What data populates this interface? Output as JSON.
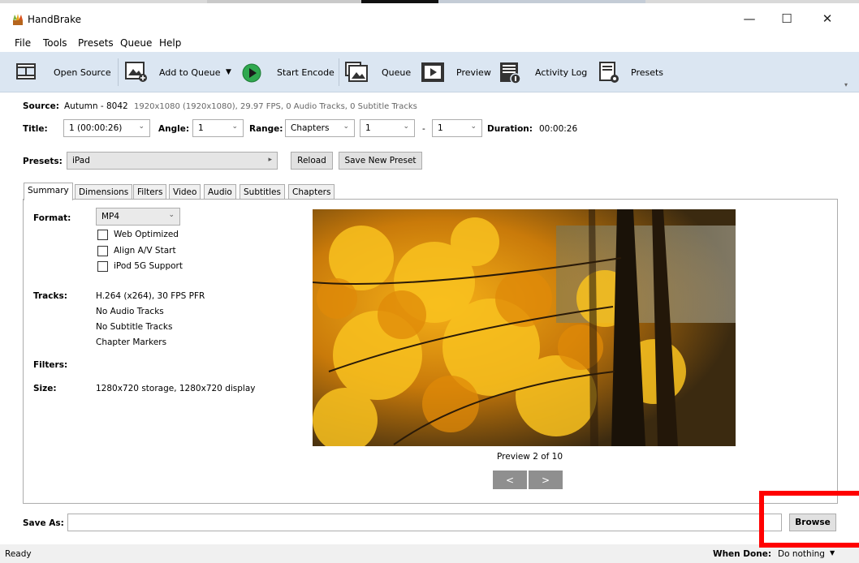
{
  "window": {
    "title": "HandBrake"
  },
  "menu": [
    "File",
    "Tools",
    "Presets",
    "Queue",
    "Help"
  ],
  "toolbar": {
    "open_source": "Open Source",
    "add_to_queue": "Add to Queue",
    "start_encode": "Start Encode",
    "queue": "Queue",
    "preview": "Preview",
    "activity_log": "Activity Log",
    "presets": "Presets"
  },
  "source": {
    "label": "Source:",
    "name": "Autumn - 8042",
    "info": "1920x1080 (1920x1080), 29.97 FPS, 0 Audio Tracks, 0 Subtitle Tracks"
  },
  "title_row": {
    "title_label": "Title:",
    "title_value": "1 (00:00:26)",
    "angle_label": "Angle:",
    "angle_value": "1",
    "range_label": "Range:",
    "range_value": "Chapters",
    "range_start": "1",
    "dash": "-",
    "range_end": "1",
    "duration_label": "Duration:",
    "duration_value": "00:00:26"
  },
  "presets_row": {
    "label": "Presets:",
    "value": "iPad",
    "reload": "Reload",
    "save_new": "Save New Preset"
  },
  "tabs": [
    "Summary",
    "Dimensions",
    "Filters",
    "Video",
    "Audio",
    "Subtitles",
    "Chapters"
  ],
  "summary": {
    "format_label": "Format:",
    "format_value": "MP4",
    "web_optimized": "Web Optimized",
    "align_av": "Align A/V Start",
    "ipod": "iPod 5G Support",
    "tracks_label": "Tracks:",
    "tracks": [
      "H.264 (x264), 30 FPS PFR",
      "No Audio Tracks",
      "No Subtitle Tracks",
      "Chapter Markers"
    ],
    "filters_label": "Filters:",
    "size_label": "Size:",
    "size_value": "1280x720 storage, 1280x720 display",
    "preview_caption": "Preview 2 of 10",
    "prev": "<",
    "next": ">"
  },
  "save_as": {
    "label": "Save As:",
    "value": "",
    "browse": "Browse"
  },
  "status": {
    "left": "Ready",
    "when_done_label": "When Done:",
    "when_done_value": "Do nothing"
  },
  "colors": {
    "toolbar_bg": "#dbe6f2",
    "highlight": "#ff0000",
    "play": "#2fa84f"
  }
}
